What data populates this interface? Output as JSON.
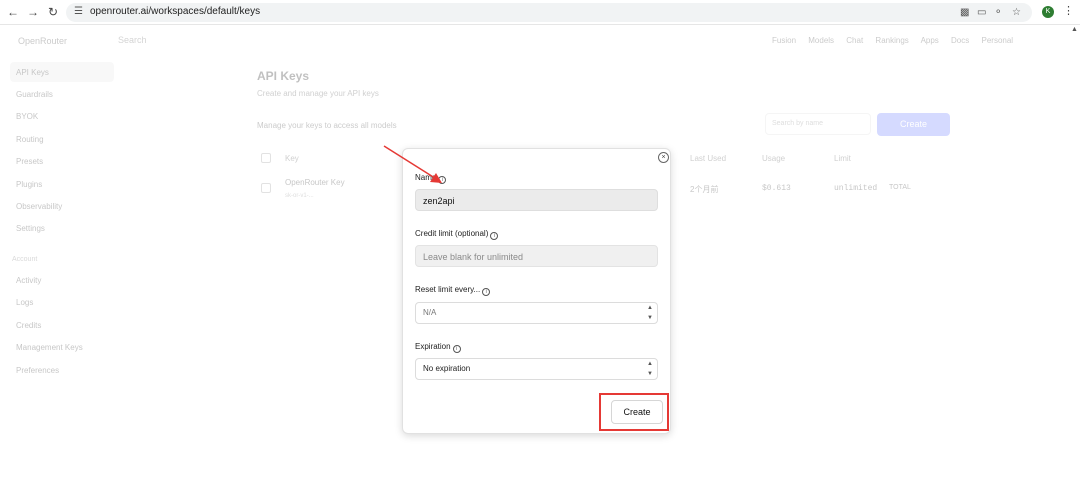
{
  "browser": {
    "url": "openrouter.ai/workspaces/default/keys",
    "profile_initial": "K",
    "icons": [
      "back-icon",
      "forward-icon",
      "reload-icon",
      "site-info-icon",
      "translate-icon",
      "cast-icon",
      "passwords-icon",
      "star-icon",
      "kebab-icon"
    ]
  },
  "topnav": {
    "brand": "OpenRouter",
    "search": "Search",
    "links": [
      "Fusion",
      "Models",
      "Chat",
      "Rankings",
      "Apps",
      "Docs",
      "Personal"
    ]
  },
  "sidebar": {
    "items": [
      "API Keys",
      "Guardrails",
      "BYOK",
      "Routing",
      "Presets",
      "Plugins",
      "Observability",
      "Settings"
    ],
    "group_label": "Account",
    "group_items": [
      "Activity",
      "Logs",
      "Credits",
      "Management Keys",
      "Preferences"
    ]
  },
  "main": {
    "title": "API Keys",
    "subtitle": "Create and manage your API keys",
    "manage_text": "Manage your keys to access all models",
    "search_placeholder": "Search by name",
    "create_label": "Create",
    "columns": [
      "Key",
      "Last Used",
      "Usage",
      "Limit"
    ],
    "rows": [
      {
        "name": "OpenRouter Key",
        "sub": "sk-or-v1-...",
        "last_used": "2个月前",
        "usage": "$0.613",
        "limit": "unlimited",
        "limit_type": "TOTAL"
      }
    ]
  },
  "modal": {
    "name_label": "Name",
    "name_value": "zen2api",
    "credit_label": "Credit limit (optional)",
    "credit_placeholder": "Leave blank for unlimited",
    "reset_label": "Reset limit every...",
    "reset_value": "N/A",
    "expiration_label": "Expiration",
    "expiration_value": "No expiration",
    "create_label": "Create"
  },
  "colors": {
    "annotation": "#e53935",
    "accent": "#6b7cff"
  }
}
